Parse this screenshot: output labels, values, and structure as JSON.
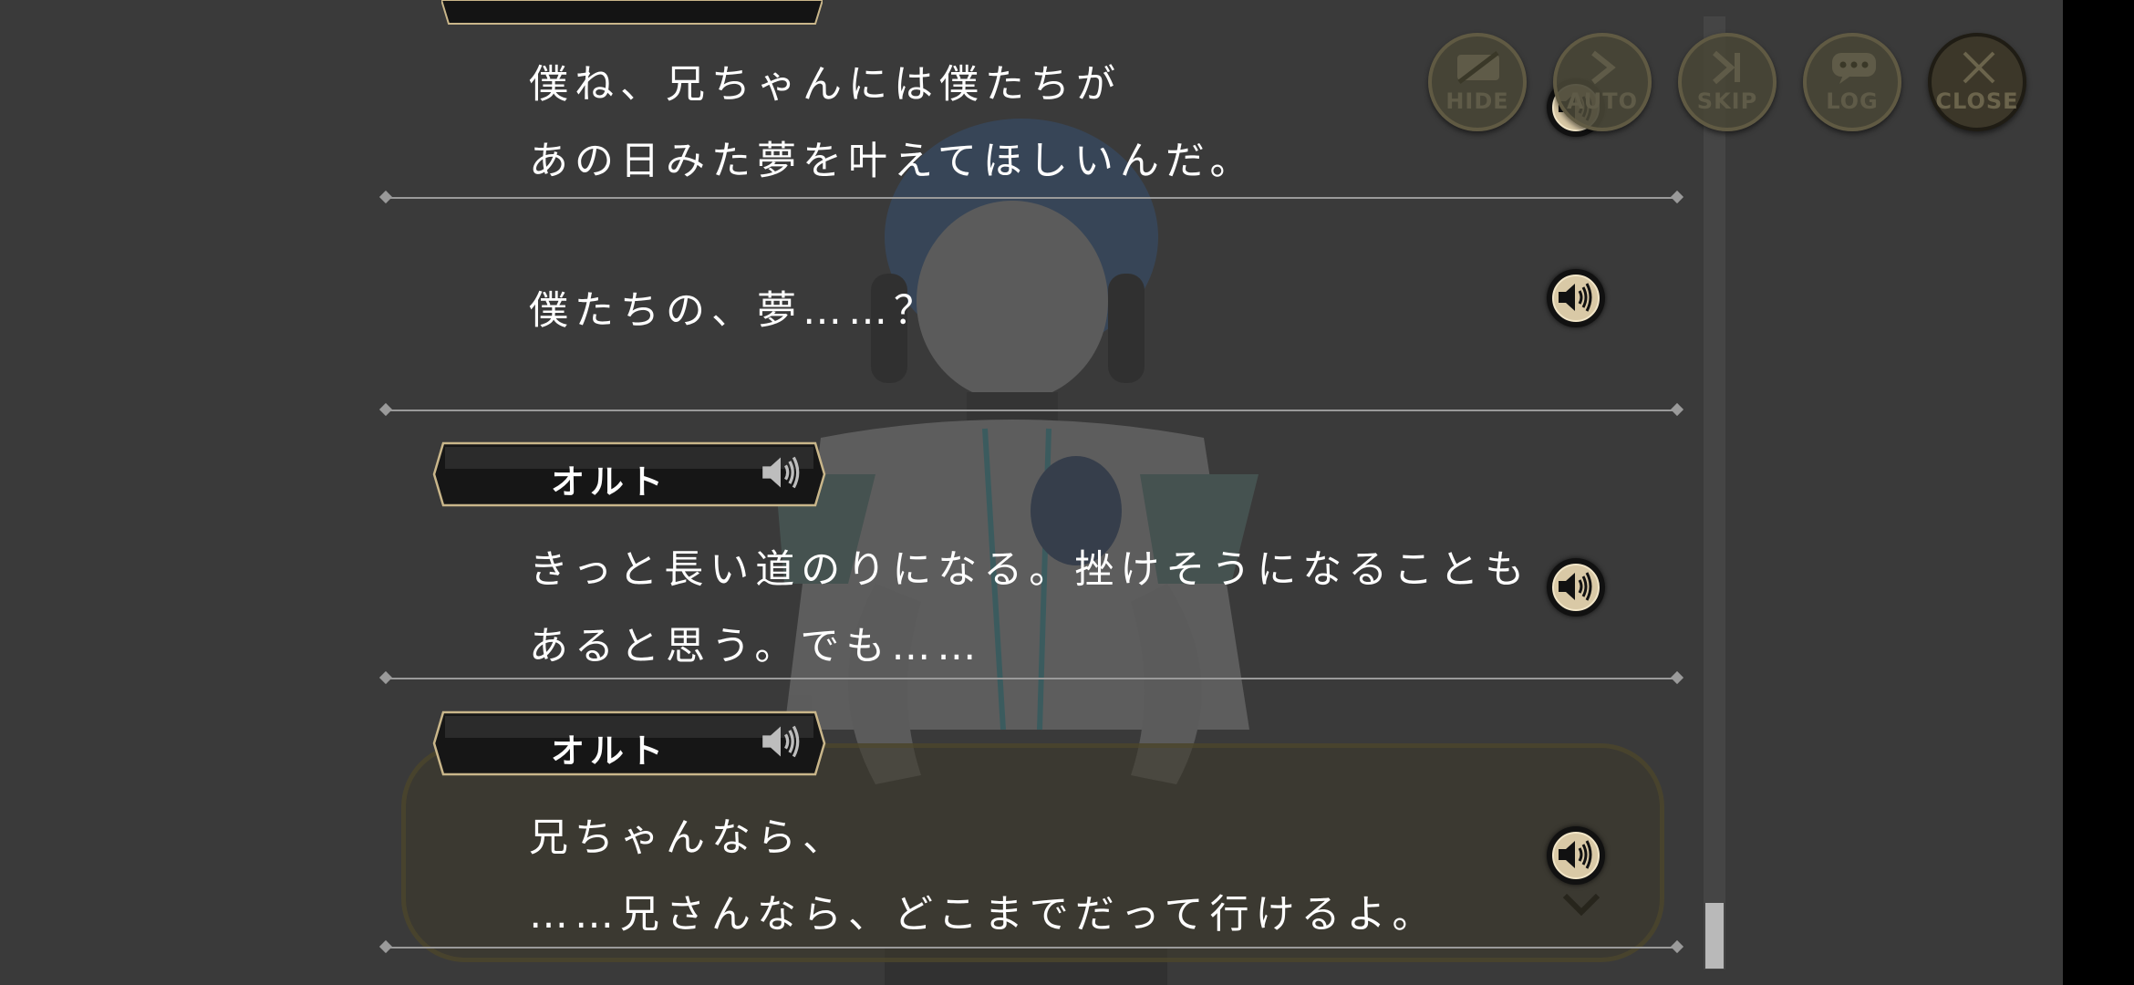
{
  "menu": {
    "hide": "HIDE",
    "auto": "AUTO",
    "skip": "SKIP",
    "log": "LOG",
    "close": "CLOSE"
  },
  "log_entries": [
    {
      "speaker": "",
      "lines": [
        "僕ね、兄ちゃんには僕たちが",
        "あの日みた夢を叶えてほしいんだ。"
      ]
    },
    {
      "speaker": "",
      "lines": [
        "僕たちの、夢……？"
      ]
    },
    {
      "speaker": "オルト",
      "lines": [
        "きっと長い道のりになる。挫けそうになることも",
        "あると思う。でも……"
      ]
    },
    {
      "speaker": "オルト",
      "lines": [
        "兄ちゃんなら、",
        "……兄さんなら、どこまでだって行けるよ。"
      ]
    }
  ],
  "colors": {
    "background": "#3a3a3a",
    "voice_button": "#d9c9a6",
    "nameplate_border": "#c9b68a",
    "divider": "#9a9a9a"
  },
  "scrollbar": {
    "position": "bottom"
  }
}
